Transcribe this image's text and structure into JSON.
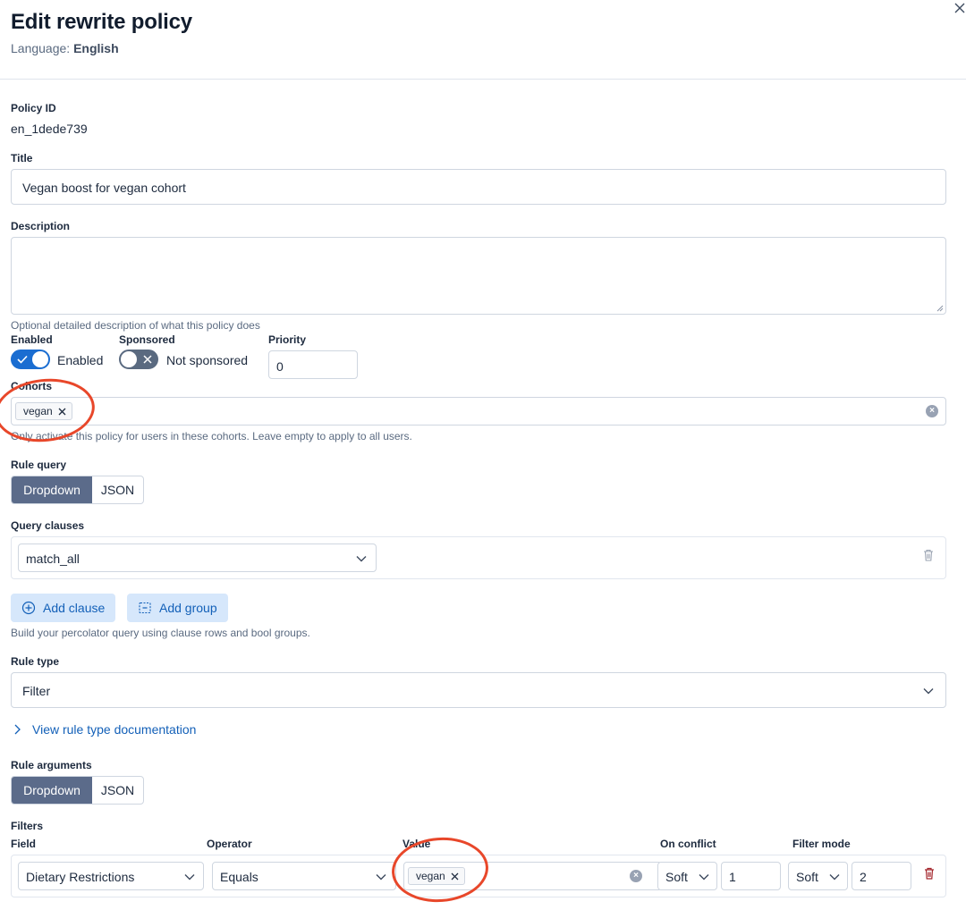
{
  "header": {
    "title": "Edit rewrite policy",
    "language_label": "Language:",
    "language_value": "English"
  },
  "policy_id": {
    "label": "Policy ID",
    "value": "en_1dede739"
  },
  "title_field": {
    "label": "Title",
    "value": "Vegan boost for vegan cohort"
  },
  "description": {
    "label": "Description",
    "value": "",
    "help": "Optional detailed description of what this policy does"
  },
  "enabled": {
    "label": "Enabled",
    "state_text": "Enabled",
    "on": true
  },
  "sponsored": {
    "label": "Sponsored",
    "state_text": "Not sponsored",
    "on": false
  },
  "priority": {
    "label": "Priority",
    "value": "0"
  },
  "cohorts": {
    "label": "Cohorts",
    "chips": [
      "vegan"
    ],
    "help": "Only activate this policy for users in these cohorts. Leave empty to apply to all users."
  },
  "rule_query": {
    "label": "Rule query",
    "modes": [
      "Dropdown",
      "JSON"
    ],
    "active_mode": "Dropdown"
  },
  "query_clauses": {
    "label": "Query clauses",
    "selected": "match_all",
    "add_clause": "Add clause",
    "add_group": "Add group",
    "help": "Build your percolator query using clause rows and bool groups."
  },
  "rule_type": {
    "label": "Rule type",
    "selected": "Filter",
    "doc_link": "View rule type documentation"
  },
  "rule_arguments": {
    "label": "Rule arguments",
    "modes": [
      "Dropdown",
      "JSON"
    ],
    "active_mode": "Dropdown"
  },
  "filters": {
    "label": "Filters",
    "columns": {
      "field": "Field",
      "operator": "Operator",
      "value": "Value",
      "on_conflict": "On conflict",
      "filter_mode": "Filter mode"
    },
    "rows": [
      {
        "field": "Dietary Restrictions",
        "operator": "Equals",
        "value_chip": "vegan",
        "on_conflict": "Soft",
        "on_conflict_number": "1",
        "filter_mode": "Soft",
        "filter_mode_number": "2"
      }
    ]
  },
  "colors": {
    "primary": "#1a6dd1",
    "segment_active": "#5b6b8a",
    "annotation": "#e8472a",
    "delete": "#a4262c"
  }
}
